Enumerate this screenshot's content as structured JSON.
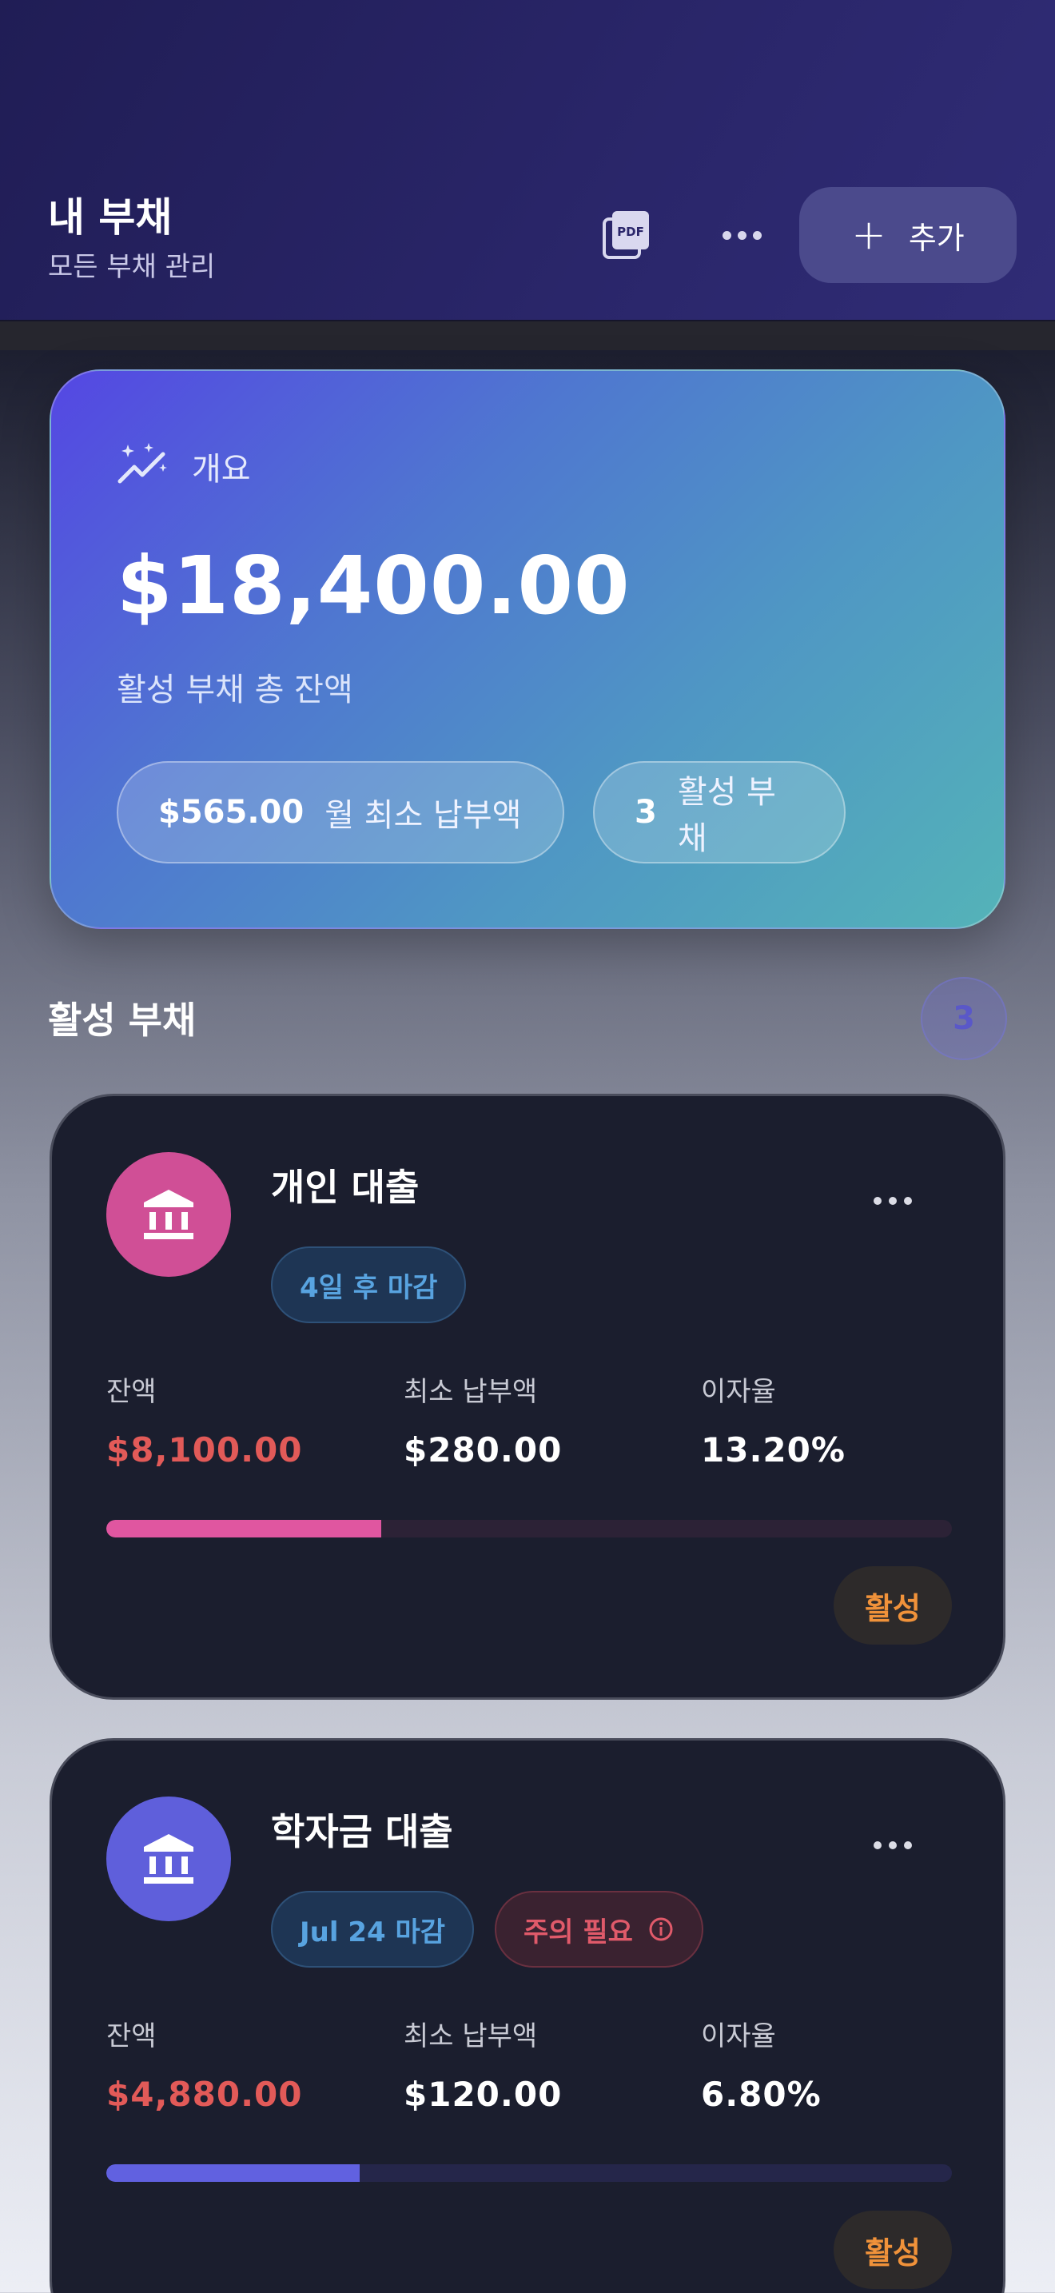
{
  "header": {
    "title": "내 부채",
    "subtitle": "모든 부채 관리",
    "pdf_icon": "pdf-export-icon",
    "more_icon": "more-horizontal-icon",
    "add_label": "추가"
  },
  "summary": {
    "label": "개요",
    "icon": "sparkle-chart-icon",
    "total": "$18,400.00",
    "caption": "활성 부채 총 잔액",
    "min_payment_value": "$565.00",
    "min_payment_label": "월 최소 납부액",
    "active_count": "3",
    "active_label": "활성 부채"
  },
  "section": {
    "title": "활성 부채",
    "count": "3"
  },
  "debts": [
    {
      "name": "개인 대출",
      "icon": "bank-icon",
      "tags": [
        {
          "text": "4일 후 마감",
          "style": "blue"
        }
      ],
      "labels": [
        "잔액",
        "최소 납부액",
        "이자율"
      ],
      "balance": "$8,100.00",
      "min_payment": "$280.00",
      "rate": "13.20%",
      "progress": 0.325,
      "status": "활성",
      "color": "#d04f96"
    },
    {
      "name": "학자금 대출",
      "icon": "bank-icon",
      "tags": [
        {
          "text": "Jul 24 마감",
          "style": "blue"
        },
        {
          "text": "주의 필요",
          "style": "red",
          "icon": "info-icon"
        }
      ],
      "labels": [
        "잔액",
        "최소 납부액",
        "이자율"
      ],
      "balance": "$4,880.00",
      "min_payment": "$120.00",
      "rate": "6.80%",
      "progress": 0.3,
      "status": "활성",
      "color": "#5f5fdb"
    }
  ]
}
